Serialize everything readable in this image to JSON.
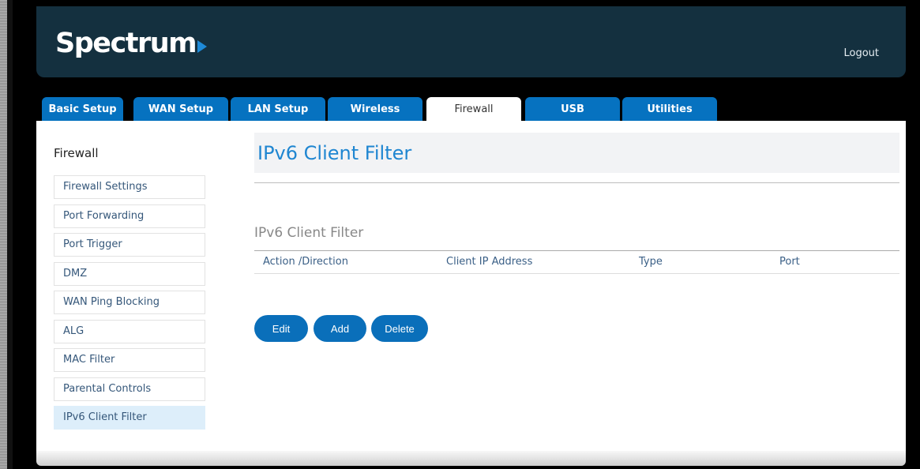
{
  "header": {
    "logo_text": "Spectrum",
    "logout_label": "Logout"
  },
  "tabs": [
    {
      "label": "Basic Setup",
      "active": false
    },
    {
      "label": "WAN Setup",
      "active": false
    },
    {
      "label": "LAN Setup",
      "active": false
    },
    {
      "label": "Wireless",
      "active": false
    },
    {
      "label": "Firewall",
      "active": true
    },
    {
      "label": "USB",
      "active": false
    },
    {
      "label": "Utilities",
      "active": false
    }
  ],
  "sidebar": {
    "title": "Firewall",
    "items": [
      {
        "label": "Firewall Settings",
        "active": false
      },
      {
        "label": "Port Forwarding",
        "active": false
      },
      {
        "label": "Port Trigger",
        "active": false
      },
      {
        "label": "DMZ",
        "active": false
      },
      {
        "label": "WAN Ping Blocking",
        "active": false
      },
      {
        "label": "ALG",
        "active": false
      },
      {
        "label": "MAC Filter",
        "active": false
      },
      {
        "label": "Parental Controls",
        "active": false
      },
      {
        "label": "IPv6 Client Filter",
        "active": true
      }
    ]
  },
  "main": {
    "page_title": "IPv6 Client Filter",
    "section_title": "IPv6 Client Filter",
    "table": {
      "columns": [
        "Action /Direction",
        "Client IP Address",
        "Type",
        "Port"
      ],
      "rows": []
    },
    "buttons": {
      "edit": "Edit",
      "add": "Add",
      "delete": "Delete"
    }
  },
  "colors": {
    "header_bg": "#14303f",
    "tab_blue": "#0672c0",
    "title_blue": "#1f86d1",
    "button_blue": "#0a6fba",
    "sidebar_active_bg": "#ddeefa"
  }
}
